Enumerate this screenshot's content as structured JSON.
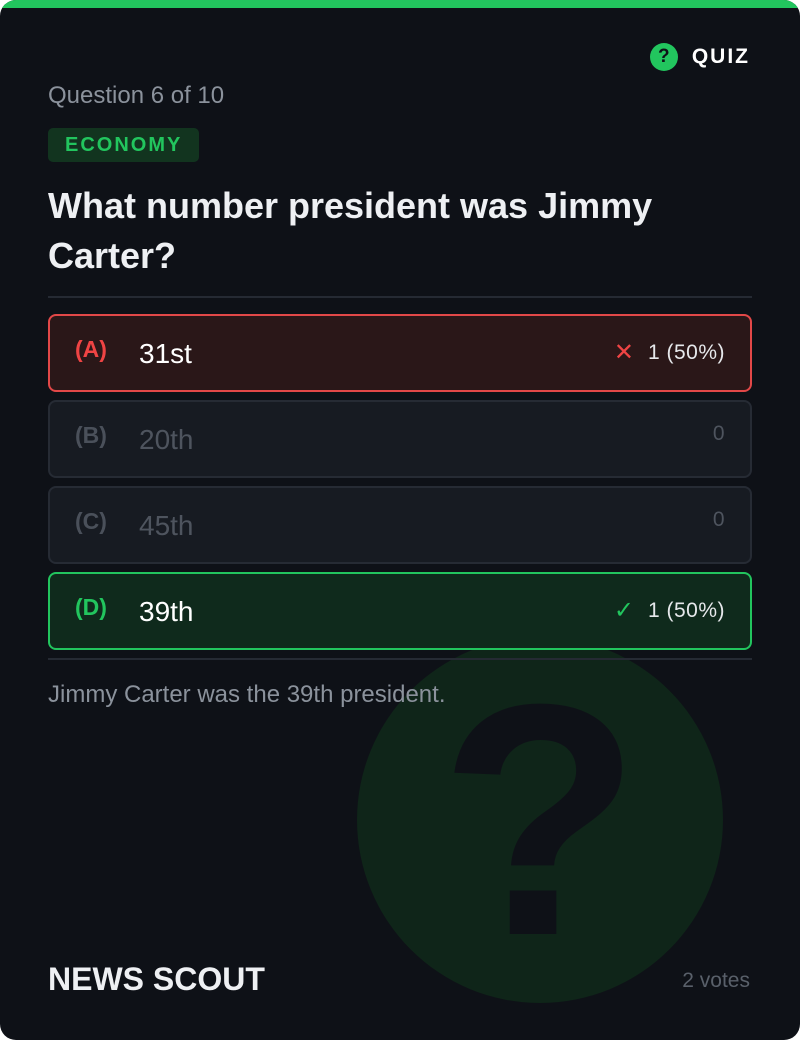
{
  "header": {
    "tag_icon": "question-circle-icon",
    "tag_icon_glyph": "?",
    "tag_label": "QUIZ"
  },
  "question": {
    "counter": "Question 6 of 10",
    "category": "ECONOMY",
    "text": "What number president was Jimmy Carter?"
  },
  "options": [
    {
      "letter": "(A)",
      "text": "31st",
      "state": "wrong",
      "mark_icon": "cross-icon",
      "mark_glyph": "✕",
      "result": "1 (50%)",
      "votes": 1,
      "percent": 50
    },
    {
      "letter": "(B)",
      "text": "20th",
      "state": "neutral",
      "result": "0",
      "votes": 0
    },
    {
      "letter": "(C)",
      "text": "45th",
      "state": "neutral",
      "result": "0",
      "votes": 0
    },
    {
      "letter": "(D)",
      "text": "39th",
      "state": "correct",
      "mark_icon": "check-icon",
      "mark_glyph": "✓",
      "result": "1 (50%)",
      "votes": 1,
      "percent": 50
    }
  ],
  "explanation": "Jimmy Carter was the 39th president.",
  "footer": {
    "brand": "NEWS SCOUT",
    "votes": "2 votes"
  },
  "watermark": {
    "icon": "question-mark-icon",
    "glyph": "?"
  },
  "colors": {
    "accent": "#22c55e",
    "wrong": "#ef4444",
    "background": "#0e1117"
  }
}
